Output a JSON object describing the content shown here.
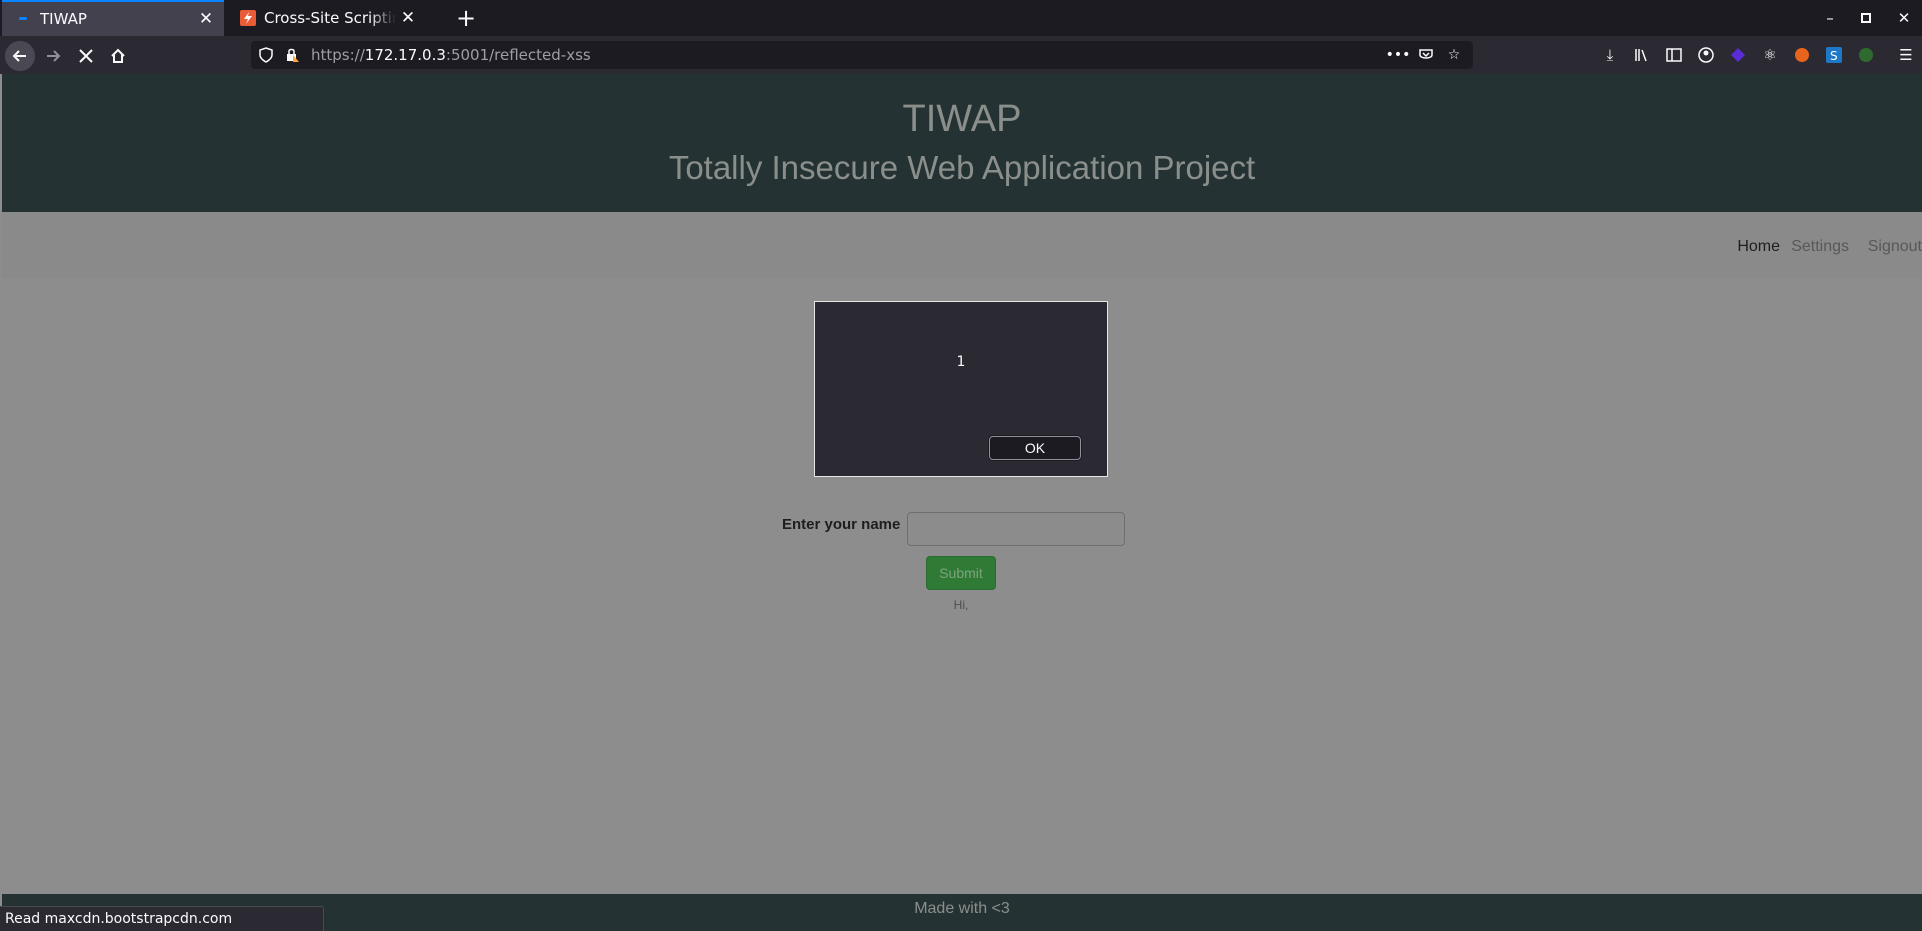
{
  "browser": {
    "tabs": [
      {
        "title": "TIWAP",
        "active": true
      },
      {
        "title": "Cross-Site Scripting (XSS)",
        "active": false
      }
    ],
    "url": {
      "scheme": "https://",
      "host": "172.17.0.3",
      "rest": ":5001/reflected-xss"
    },
    "status_text": "Read maxcdn.bootstrapcdn.com"
  },
  "site": {
    "title": "TIWAP",
    "subtitle": "Totally Insecure Web Application Project",
    "nav": {
      "home": "Home",
      "settings": "Settings",
      "signout": "Signout"
    },
    "form": {
      "label": "Enter your name",
      "input_value": "",
      "submit": "Submit"
    },
    "greeting": "Hi,",
    "footer": "Made with <3"
  },
  "dialog": {
    "message": "1",
    "ok_label": "OK"
  },
  "colors": {
    "header_bg": "#253233",
    "accent_tab": "#0a84ff",
    "submit_bg": "#2f7a34"
  }
}
